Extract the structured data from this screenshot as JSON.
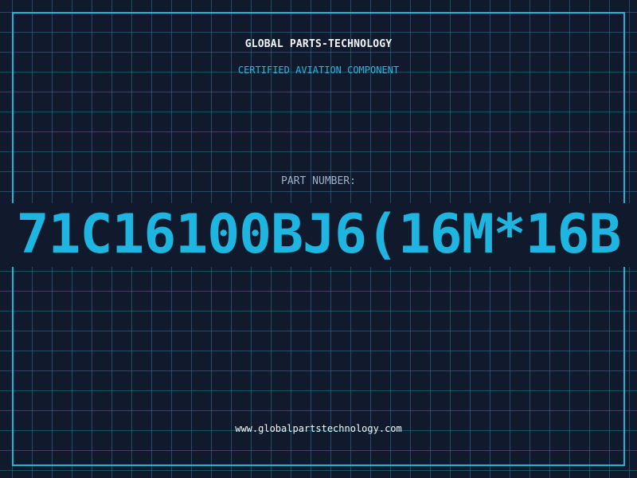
{
  "brand": {
    "name": "GLOBAL PARTS-TECHNOLOGY",
    "tagline": "CERTIFIED AVIATION COMPONENT"
  },
  "part": {
    "label": "PART NUMBER:",
    "number": "71C16100BJ6(16M*16B"
  },
  "footer": {
    "website": "www.globalpartstechnology.com"
  },
  "colors": {
    "background": "#111a2d",
    "grid": "#1f6a86",
    "accent": "#1eb6e0",
    "text": "#f4f6fa",
    "muted": "#9fb1c8"
  }
}
